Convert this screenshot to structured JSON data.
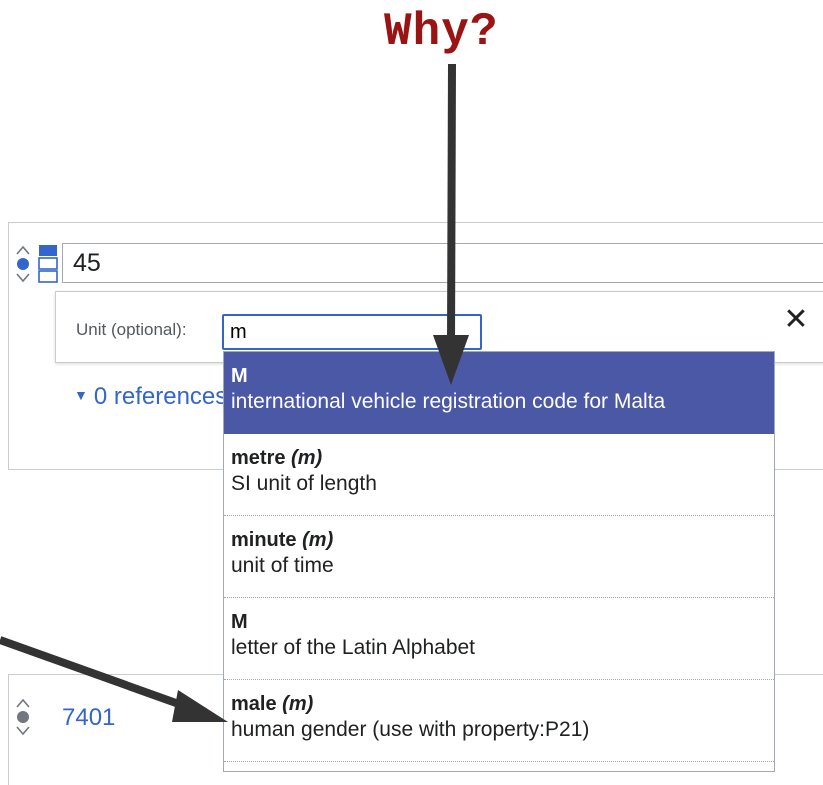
{
  "annotation": {
    "title": "Why?"
  },
  "statement": {
    "value": "45",
    "unit_label": "Unit (optional):",
    "unit_value": "m",
    "close_glyph": "✕",
    "references_text": "0 references"
  },
  "suggestions": [
    {
      "label": "M",
      "alias": "",
      "description": "international vehicle registration code for Malta",
      "active": true
    },
    {
      "label": "metre",
      "alias": "(m)",
      "description": "SI unit of length"
    },
    {
      "label": "minute",
      "alias": "(m)",
      "description": "unit of time"
    },
    {
      "label": "M",
      "alias": "",
      "description": "letter of the Latin Alphabet"
    },
    {
      "label": "male",
      "alias": "(m)",
      "description": "human gender (use with property:P21)"
    }
  ],
  "statement2": {
    "value": "7401"
  },
  "colors": {
    "annotation": "#9a1414",
    "highlight": "#4a58a6",
    "link": "#3366cc",
    "arrow": "#333333"
  }
}
